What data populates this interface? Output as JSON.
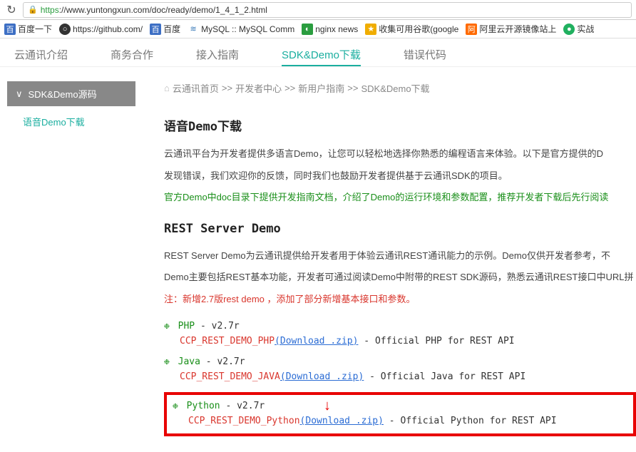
{
  "browser": {
    "url_proto": "https",
    "url_rest": "://www.yuntongxun.com/doc/ready/demo/1_4_1_2.html"
  },
  "bookmarks": [
    {
      "label": "百度一下"
    },
    {
      "label": "https://github.com/"
    },
    {
      "label": "百度"
    },
    {
      "label": "MySQL :: MySQL Comm"
    },
    {
      "label": "nginx news"
    },
    {
      "label": "收集可用谷歌(google"
    },
    {
      "label": "阿里云开源镜像站上"
    },
    {
      "label": "实战"
    }
  ],
  "nav": [
    "云通讯介绍",
    "商务合作",
    "接入指南",
    "SDK&Demo下载",
    "错误代码"
  ],
  "nav_active_index": 3,
  "sidebar": {
    "heading": "SDK&Demo源码",
    "link": "语音Demo下载"
  },
  "crumbs": [
    "云通讯首页",
    "开发者中心",
    "新用户指南",
    "SDK&Demo下载"
  ],
  "sep": ">>",
  "section1": {
    "title": "语音Demo下载",
    "p1": "云通讯平台为开发者提供多语言Demo，让您可以轻松地选择你熟悉的编程语言来体验。以下是官方提供的D",
    "p2": "发现错误，我们欢迎你的反馈，同时我们也鼓励开发者提供基于云通讯SDK的项目。",
    "green": "官方Demo中doc目录下提供开发指南文档，介绍了Demo的运行环境和参数配置，推荐开发者下载后先行阅读"
  },
  "section2": {
    "title": "REST Server Demo",
    "p1": "REST Server Demo为云通讯提供给开发者用于体验云通讯REST通讯能力的示例。Demo仅供开发者参考，不",
    "p2": "Demo主要包括REST基本功能，开发者可通过阅读Demo中附带的REST SDK源码，熟悉云通讯REST接口中URL拼",
    "red": "注：新增2.7版rest demo ，添加了部分新增基本接口和参数。"
  },
  "demos": [
    {
      "lang": "PHP",
      "ver": "v2.7r",
      "pkg": "CCP_REST_DEMO_PHP",
      "dl": "(Download .zip)",
      "desc": "Official PHP for REST API"
    },
    {
      "lang": "Java",
      "ver": "v2.7r",
      "pkg": "CCP_REST_DEMO_JAVA",
      "dl": "(Download .zip)",
      "desc": "Official Java for REST API"
    },
    {
      "lang": "Python",
      "ver": "v2.7r",
      "pkg": "CCP_REST_DEMO_Python",
      "dl": "(Download .zip)",
      "desc": "Official Python for REST API"
    }
  ],
  "dash": " - "
}
